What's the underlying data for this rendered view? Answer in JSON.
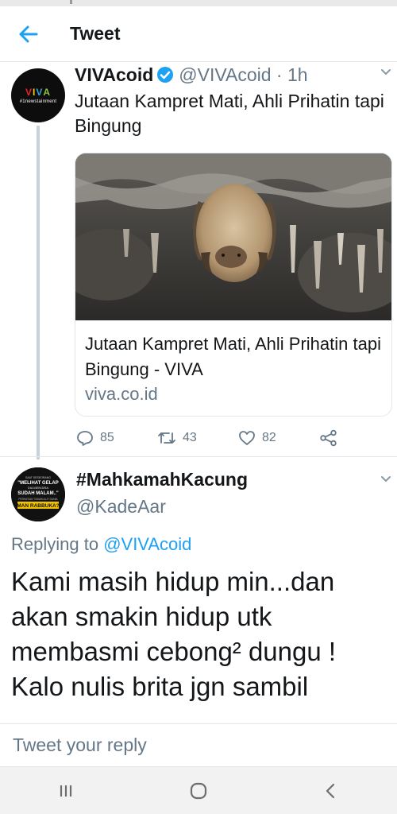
{
  "header": {
    "title": "Tweet",
    "back_icon": "arrow-left-icon"
  },
  "tweet": {
    "author_name": "VIVAcoid",
    "handle_time": "@VIVAcoid · 1h",
    "text": "Jutaan Kampret Mati, Ahli Prihatin tapi Bingung",
    "avatar": {
      "logo_letters": [
        "V",
        "I",
        "V",
        "A"
      ],
      "logo_colors": [
        "#e8232a",
        "#f7c515",
        "#2aa3e0",
        "#8bc53f"
      ],
      "tagline": "#1newstainment"
    },
    "card": {
      "title": "Jutaan Kampret Mati, Ahli Prihatin tapi Bingung - VIVA",
      "domain": "viva.co.id"
    },
    "actions": {
      "replies": "85",
      "retweets": "43",
      "likes": "82"
    }
  },
  "reply": {
    "author_name": "#MahkamahKacung",
    "handle": "@KadeAar",
    "replying_prefix": "Replying to ",
    "replying_to": "@VIVAcoid",
    "text": "Kami masih hidup min...dan akan smakin hidup utk membasmi cebong² dungu ! Kalo nulis brita jgn sambil",
    "avatar_lines": [
      "SAAT SESEORANG",
      "\"MELIHAT GELAP",
      "DIA MENGIRA",
      "SUDAH MALAM..\"",
      "PERHATIAN \"DIDAHULUI\" DUNIA",
      "MAN RABBUKA?"
    ]
  },
  "compose": {
    "placeholder": "Tweet your reply"
  },
  "colors": {
    "accent": "#1da1f2",
    "text": "#14171a",
    "muted": "#657786",
    "border": "#e1e8ed"
  }
}
